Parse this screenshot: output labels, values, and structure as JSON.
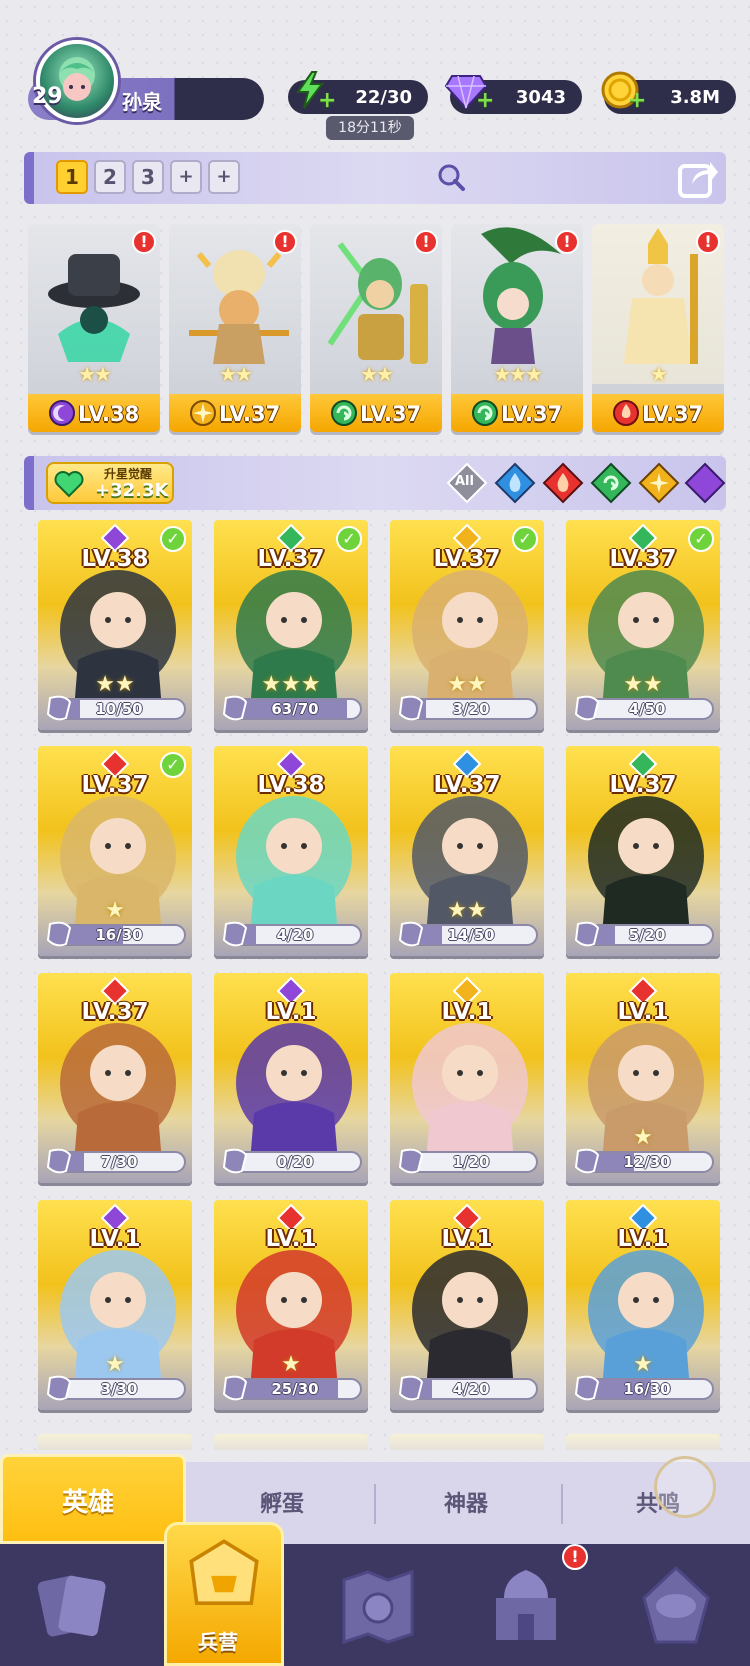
{
  "player": {
    "level": "29",
    "name": "孙泉"
  },
  "resources": {
    "energy": "22/30",
    "energy_timer": "18分11秒",
    "gems": "3043",
    "gold": "3.8M"
  },
  "team_slots": [
    "1",
    "2",
    "3",
    "+",
    "+"
  ],
  "team": [
    {
      "level": "LV.38",
      "element": "dark",
      "stars": "★★"
    },
    {
      "level": "LV.37",
      "element": "light",
      "stars": "★★"
    },
    {
      "level": "LV.37",
      "element": "wind",
      "stars": "★★"
    },
    {
      "level": "LV.37",
      "element": "wind",
      "stars": "★★★"
    },
    {
      "level": "LV.37",
      "element": "fire",
      "stars": "★"
    }
  ],
  "awaken": {
    "label": "升星觉醒",
    "value": "+32.3K"
  },
  "filters": [
    "All",
    "water",
    "fire",
    "wind",
    "light",
    "dark"
  ],
  "filter_all_label": "All",
  "heroes": [
    {
      "level": "LV.38",
      "element": "dark",
      "progress": "10/50",
      "fraction": 0.2,
      "checked": true,
      "stars": "★★"
    },
    {
      "level": "LV.37",
      "element": "wind",
      "progress": "63/70",
      "fraction": 0.9,
      "checked": true,
      "stars": "★★★"
    },
    {
      "level": "LV.37",
      "element": "light",
      "progress": "3/20",
      "fraction": 0.15,
      "checked": true,
      "stars": "★★"
    },
    {
      "level": "LV.37",
      "element": "wind",
      "progress": "4/50",
      "fraction": 0.08,
      "checked": true,
      "stars": "★★"
    },
    {
      "level": "LV.37",
      "element": "fire",
      "progress": "16/30",
      "fraction": 0.53,
      "checked": true,
      "stars": "★"
    },
    {
      "level": "LV.38",
      "element": "dark",
      "progress": "4/20",
      "fraction": 0.2,
      "checked": false,
      "stars": ""
    },
    {
      "level": "LV.37",
      "element": "water",
      "progress": "14/50",
      "fraction": 0.28,
      "checked": false,
      "stars": "★★"
    },
    {
      "level": "LV.37",
      "element": "wind",
      "progress": "5/20",
      "fraction": 0.25,
      "checked": false,
      "stars": ""
    },
    {
      "level": "LV.37",
      "element": "fire",
      "progress": "7/30",
      "fraction": 0.23,
      "checked": false,
      "stars": ""
    },
    {
      "level": "LV.1",
      "element": "dark",
      "progress": "0/20",
      "fraction": 0.0,
      "checked": false,
      "stars": ""
    },
    {
      "level": "LV.1",
      "element": "light",
      "progress": "1/20",
      "fraction": 0.05,
      "checked": false,
      "stars": ""
    },
    {
      "level": "LV.1",
      "element": "fire",
      "progress": "12/30",
      "fraction": 0.4,
      "checked": false,
      "stars": "★"
    },
    {
      "level": "LV.1",
      "element": "dark",
      "progress": "3/30",
      "fraction": 0.1,
      "checked": false,
      "stars": "★"
    },
    {
      "level": "LV.1",
      "element": "fire",
      "progress": "25/30",
      "fraction": 0.83,
      "checked": false,
      "stars": "★"
    },
    {
      "level": "LV.1",
      "element": "fire",
      "progress": "4/20",
      "fraction": 0.2,
      "checked": false,
      "stars": ""
    },
    {
      "level": "LV.1",
      "element": "water",
      "progress": "16/30",
      "fraction": 0.53,
      "checked": false,
      "stars": "★"
    }
  ],
  "tabs": [
    "英雄",
    "孵蛋",
    "神器",
    "共鸣"
  ],
  "bottom_nav": {
    "active_label": "兵营",
    "items": [
      "cards",
      "barracks",
      "map",
      "temple",
      "guild"
    ]
  },
  "colors": {
    "accent_yellow": "#ffc83a",
    "purple": "#7c6ecb",
    "dark_nav": "#3c3862",
    "fire": "#e8322f",
    "water": "#2f8fe0",
    "wind": "#34b65a",
    "light": "#f2b21b",
    "dark": "#8e47d9"
  }
}
